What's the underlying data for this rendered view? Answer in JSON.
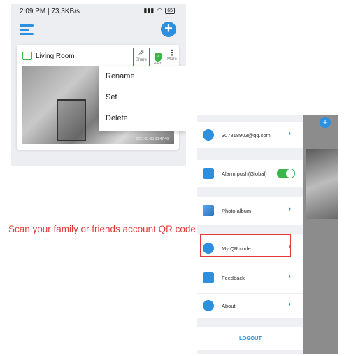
{
  "left_screen": {
    "status_bar": {
      "time": "2:09 PM | 73.3KB/s",
      "battery": "65"
    },
    "card": {
      "room_name": "Living Room",
      "actions": {
        "share_label": "Share",
        "alert_label": "Alert",
        "more_label": "More"
      },
      "feed_timestamp": "2021-01-05 08:47:46"
    },
    "context_menu": {
      "items": [
        "Rename",
        "Set",
        "Delete"
      ]
    }
  },
  "caption": "Scan your family or friends account QR code",
  "right_screen": {
    "menu": {
      "account": "307818903@qq.com",
      "alarm_push": "Alarm push(Global)",
      "alarm_push_enabled": true,
      "photo_album": "Photo album",
      "my_qr_code": "My QR code",
      "feedback": "Feedback",
      "about": "About",
      "logout": "LOGOUT"
    },
    "colors": {
      "accent": "#2d8fe0",
      "toggle_on": "#39b54a",
      "highlight": "#e03a3a"
    }
  }
}
